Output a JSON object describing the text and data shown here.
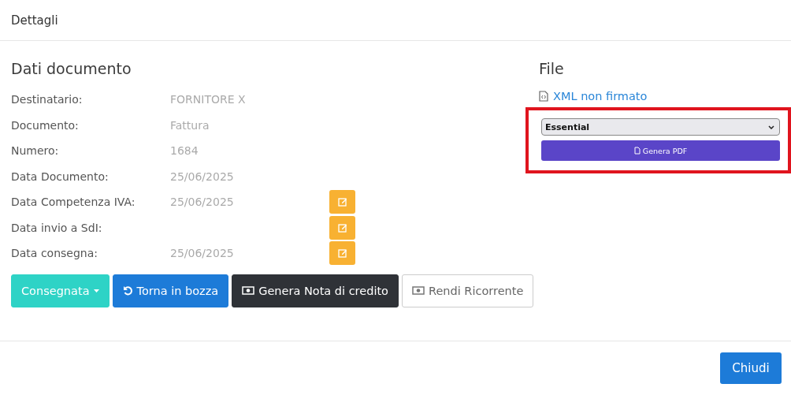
{
  "modal": {
    "title": "Dettagli"
  },
  "document": {
    "heading": "Dati documento",
    "rows": [
      {
        "label": "Destinatario:",
        "value": "FORNITORE X",
        "editable": false
      },
      {
        "label": "Documento:",
        "value": "Fattura",
        "editable": false
      },
      {
        "label": "Numero:",
        "value": "1684",
        "editable": false
      },
      {
        "label": "Data Documento:",
        "value": "25/06/2025",
        "editable": false
      },
      {
        "label": "Data Competenza IVA:",
        "value": "25/06/2025",
        "editable": true
      },
      {
        "label": "Data invio a SdI:",
        "editable": true
      },
      {
        "label": "Data consegna:",
        "value": "25/06/2025",
        "editable": true
      }
    ]
  },
  "actions": [
    {
      "label": "Consegnata",
      "kind": "dropdown"
    },
    {
      "label": "Torna in bozza",
      "kind": "undo"
    },
    {
      "label": "Genera Nota di credito",
      "kind": "dark"
    },
    {
      "label": "Rendi Ricorrente",
      "kind": "outline"
    }
  ],
  "file": {
    "heading": "File",
    "link": "XML non firmato",
    "template": "Essential",
    "pdf_button": "Genera PDF",
    "highlighted": true
  },
  "footer": {
    "close_button": "Chiudi"
  }
}
